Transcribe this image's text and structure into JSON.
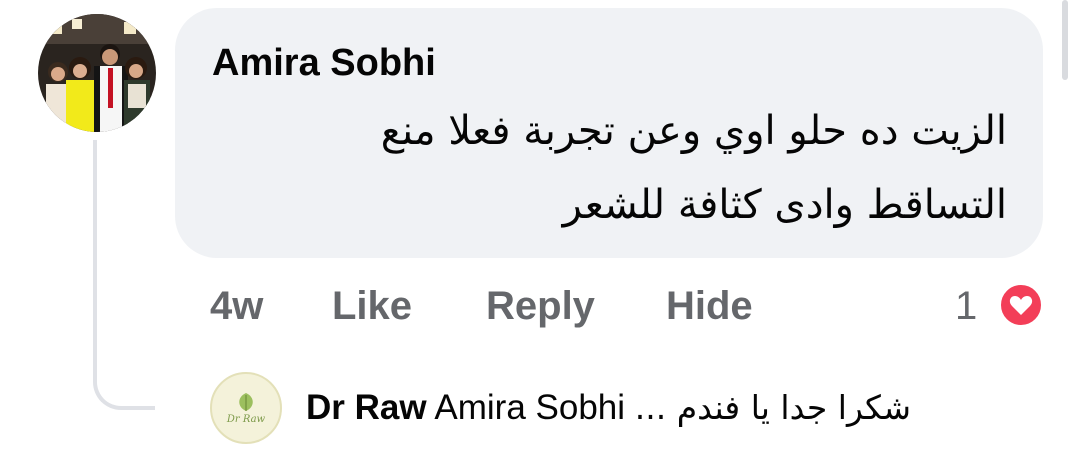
{
  "comment": {
    "author": "Amira Sobhi",
    "text_line1": "الزيت ده حلو اوي وعن تجربة فعلا منع",
    "text_line2": "التساقط وادى كثافة للشعر",
    "time": "4w",
    "like_label": "Like",
    "reply_label": "Reply",
    "hide_label": "Hide",
    "reaction_count": "1",
    "reaction_type": "love"
  },
  "reply": {
    "author": "Dr Raw",
    "mention": "Amira Sobhi",
    "snippet": "شكرا جدا يا فندم ...",
    "avatar_logo_text": "Dr Raw"
  },
  "colors": {
    "bubble": "#f0f2f5",
    "secondary_text": "#65676b",
    "love_reaction": "#f33e58",
    "thread_line": "#dfe1e6"
  }
}
